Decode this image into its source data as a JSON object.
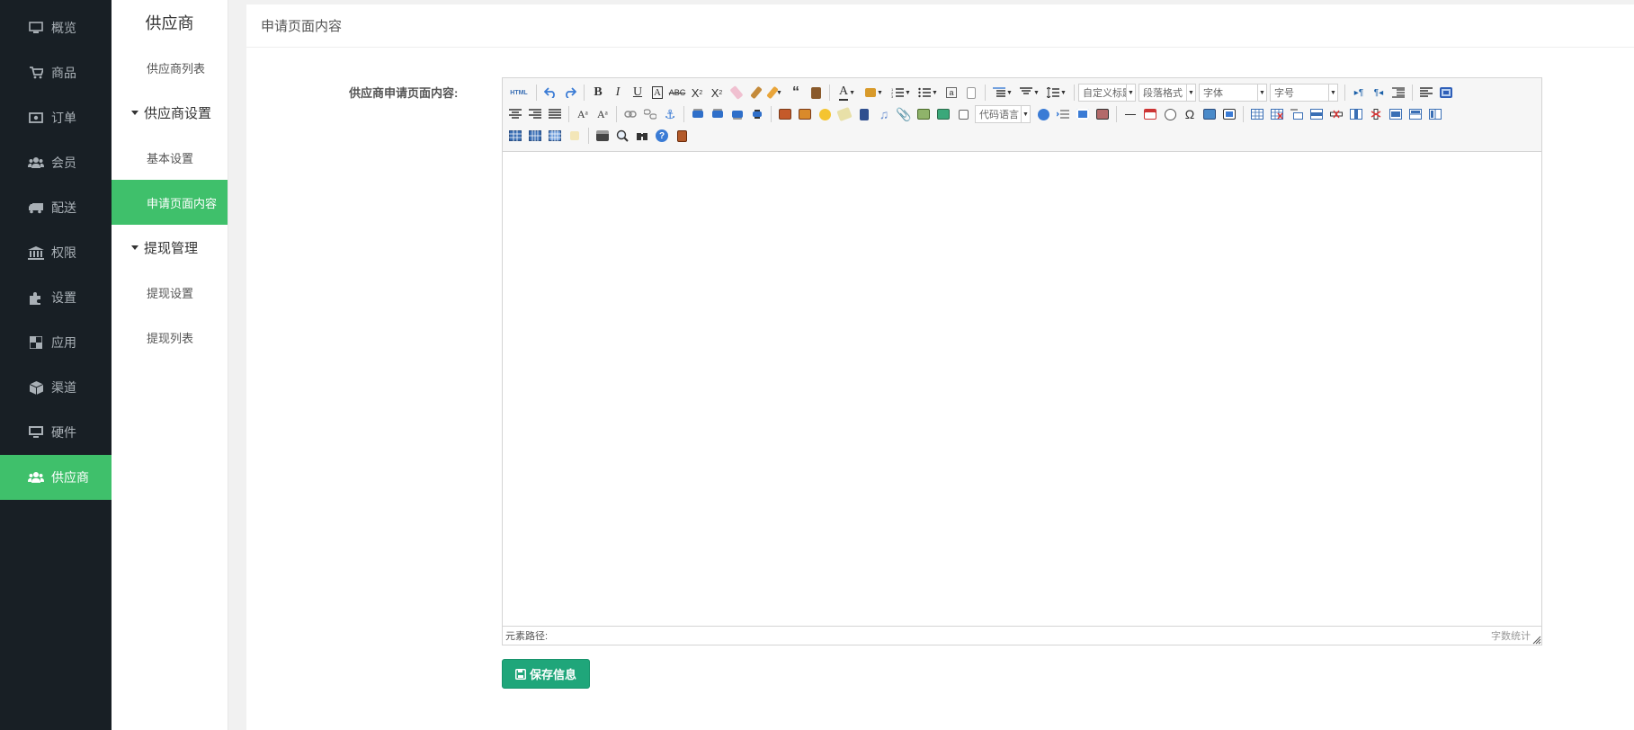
{
  "nav_primary": [
    {
      "label": "概览",
      "icon": "monitor-icon"
    },
    {
      "label": "商品",
      "icon": "cart-icon"
    },
    {
      "label": "订单",
      "icon": "money-icon"
    },
    {
      "label": "会员",
      "icon": "users-icon"
    },
    {
      "label": "配送",
      "icon": "truck-icon"
    },
    {
      "label": "权限",
      "icon": "bank-icon"
    },
    {
      "label": "设置",
      "icon": "puzzle-icon"
    },
    {
      "label": "应用",
      "icon": "grid-icon"
    },
    {
      "label": "渠道",
      "icon": "cube-icon"
    },
    {
      "label": "硬件",
      "icon": "desktop-icon"
    },
    {
      "label": "供应商",
      "icon": "users-icon",
      "active": true
    }
  ],
  "nav_secondary": {
    "title": "供应商",
    "supplier_list": "供应商列表",
    "group_settings": "供应商设置",
    "basic_settings": "基本设置",
    "apply_page_content": "申请页面内容",
    "group_withdraw": "提现管理",
    "withdraw_settings": "提现设置",
    "withdraw_list": "提现列表"
  },
  "main": {
    "header": "申请页面内容",
    "field_label": "供应商申请页面内容:"
  },
  "editor": {
    "source_label": "HTML",
    "combo_heading": "自定义标题",
    "combo_paragraph": "段落格式",
    "combo_font": "字体",
    "combo_size": "字号",
    "combo_code": "代码语言",
    "footer_path": "元素路径:",
    "footer_count": "字数统计"
  },
  "save_button": "保存信息",
  "colors": {
    "sidebar_bg": "#181f25",
    "accent_green": "#3fc06b",
    "save_button": "#1fa67a"
  }
}
